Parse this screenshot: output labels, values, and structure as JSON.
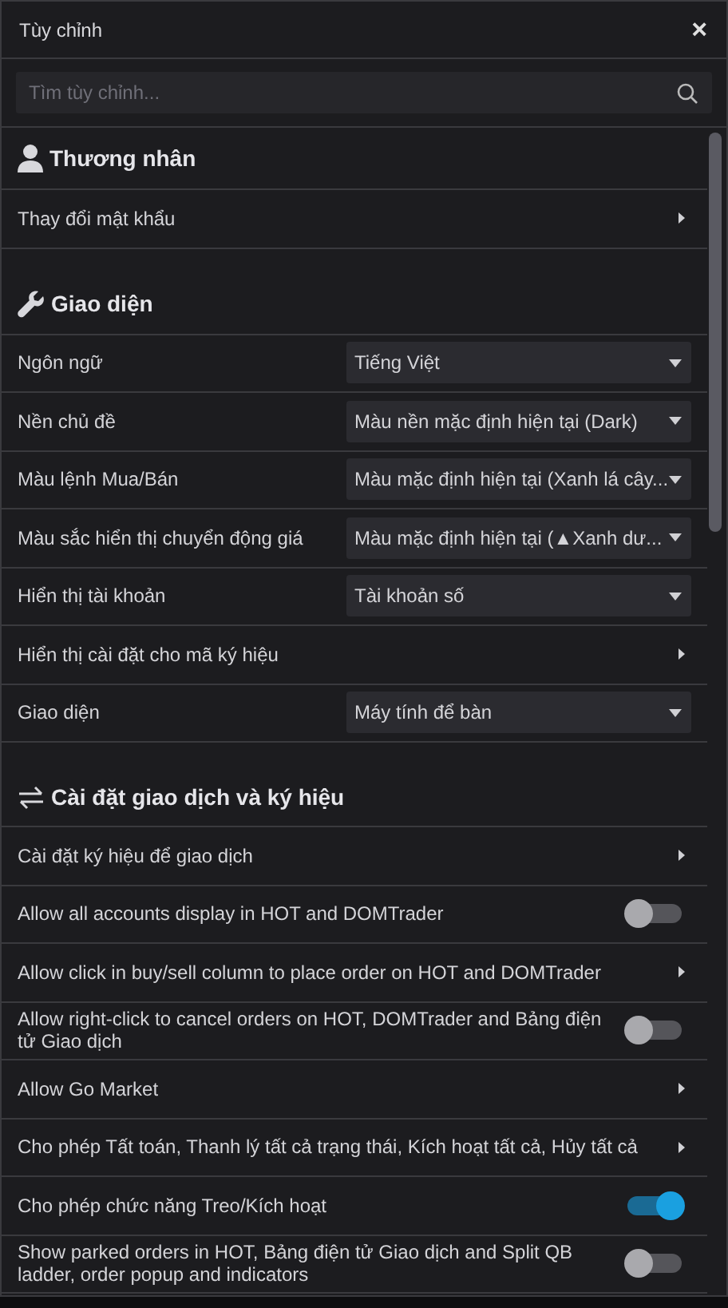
{
  "window": {
    "title": "Tùy chỉnh",
    "close": "×"
  },
  "search": {
    "placeholder": "Tìm tùy chỉnh..."
  },
  "sections": [
    {
      "title": "Thương nhân",
      "items": [
        {
          "kind": "link",
          "label": "Thay đổi mật khẩu"
        }
      ]
    },
    {
      "title": "Giao diện",
      "items": [
        {
          "kind": "select",
          "label": "Ngôn ngữ",
          "value": "Tiếng Việt"
        },
        {
          "kind": "select",
          "label": "Nền chủ đề",
          "value": "Màu nền mặc định hiện tại (Dark)"
        },
        {
          "kind": "select",
          "label": "Màu lệnh Mua/Bán",
          "value": "Màu mặc định hiện tại (Xanh lá cây..."
        },
        {
          "kind": "select",
          "label": "Màu sắc hiển thị chuyển động giá",
          "value": "Màu mặc định hiện tại (▲Xanh dư..."
        },
        {
          "kind": "select",
          "label": "Hiển thị tài khoản",
          "value": "Tài khoản số"
        },
        {
          "kind": "link",
          "label": "Hiển thị cài đặt cho mã ký hiệu"
        },
        {
          "kind": "select",
          "label": "Giao diện",
          "value": "Máy tính để bàn"
        }
      ]
    },
    {
      "title": "Cài đặt giao dịch và ký hiệu",
      "items": [
        {
          "kind": "link",
          "label": "Cài đặt ký hiệu để giao dịch"
        },
        {
          "kind": "toggle",
          "label": "Allow all accounts display in HOT and DOMTrader",
          "on": false
        },
        {
          "kind": "link",
          "label": "Allow click in buy/sell column to place order on HOT and DOMTrader"
        },
        {
          "kind": "toggle",
          "label": "Allow right-click to cancel orders on HOT, DOMTrader and Bảng điện tử Giao dịch",
          "on": false
        },
        {
          "kind": "link",
          "label": "Allow Go Market"
        },
        {
          "kind": "link",
          "label": "Cho phép Tất toán, Thanh lý tất cả trạng thái, Kích hoạt tất cả, Hủy tất cả"
        },
        {
          "kind": "toggle",
          "label": "Cho phép chức năng Treo/Kích hoạt",
          "on": true
        },
        {
          "kind": "toggle",
          "label": "Show parked orders in HOT, Bảng điện tử Giao dịch and Split QB ladder, order popup and indicators",
          "on": false
        }
      ]
    }
  ]
}
